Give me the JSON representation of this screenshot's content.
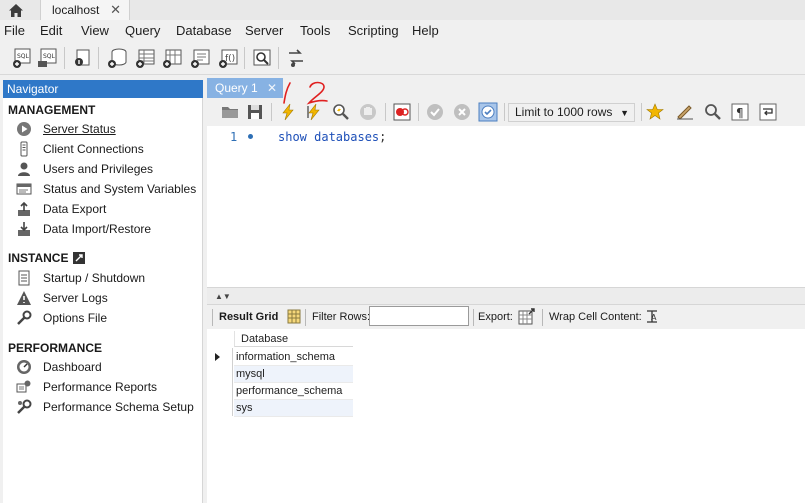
{
  "titlebar": {
    "connection_tab": "localhost",
    "close_glyph": "✕"
  },
  "menu": {
    "items": [
      "File",
      "Edit",
      "View",
      "Query",
      "Database",
      "Server",
      "Tools",
      "Scripting",
      "Help"
    ]
  },
  "navigator": {
    "header": "Navigator",
    "sections": [
      {
        "title": "MANAGEMENT",
        "items": [
          {
            "label": "Server Status",
            "icon": "server-status-icon",
            "active": true
          },
          {
            "label": "Client Connections",
            "icon": "client-connections-icon"
          },
          {
            "label": "Users and Privileges",
            "icon": "user-icon"
          },
          {
            "label": "Status and System Variables",
            "icon": "system-variables-icon"
          },
          {
            "label": "Data Export",
            "icon": "data-export-icon"
          },
          {
            "label": "Data Import/Restore",
            "icon": "data-import-icon"
          }
        ]
      },
      {
        "title": "INSTANCE",
        "items": [
          {
            "label": "Startup / Shutdown",
            "icon": "startup-icon"
          },
          {
            "label": "Server Logs",
            "icon": "warning-icon"
          },
          {
            "label": "Options File",
            "icon": "wrench-icon"
          }
        ]
      },
      {
        "title": "PERFORMANCE",
        "items": [
          {
            "label": "Dashboard",
            "icon": "dashboard-icon"
          },
          {
            "label": "Performance Reports",
            "icon": "reports-icon"
          },
          {
            "label": "Performance Schema Setup",
            "icon": "schema-setup-icon"
          }
        ]
      }
    ]
  },
  "query_tab": {
    "label": "Query 1",
    "close_glyph": "✕"
  },
  "editor_toolbar": {
    "limit_select": "Limit to 1000 rows"
  },
  "editor": {
    "line_number": "1",
    "code": "show databases",
    "code_terminator": ";"
  },
  "result_toolbar": {
    "result_grid": "Result Grid",
    "filter_rows": "Filter Rows:",
    "filter_value": "",
    "export": "Export:",
    "wrap_cell": "Wrap Cell Content:"
  },
  "result_grid": {
    "column": "Database",
    "rows": [
      "information_schema",
      "mysql",
      "performance_schema",
      "sys"
    ]
  },
  "annotations": {
    "mark_1": "1",
    "mark_2": "2",
    "color": "#e02020"
  },
  "colors": {
    "accent": "#2f78c8",
    "query_tab": "#87b2e3",
    "code_keyword": "#1d4fb8"
  }
}
